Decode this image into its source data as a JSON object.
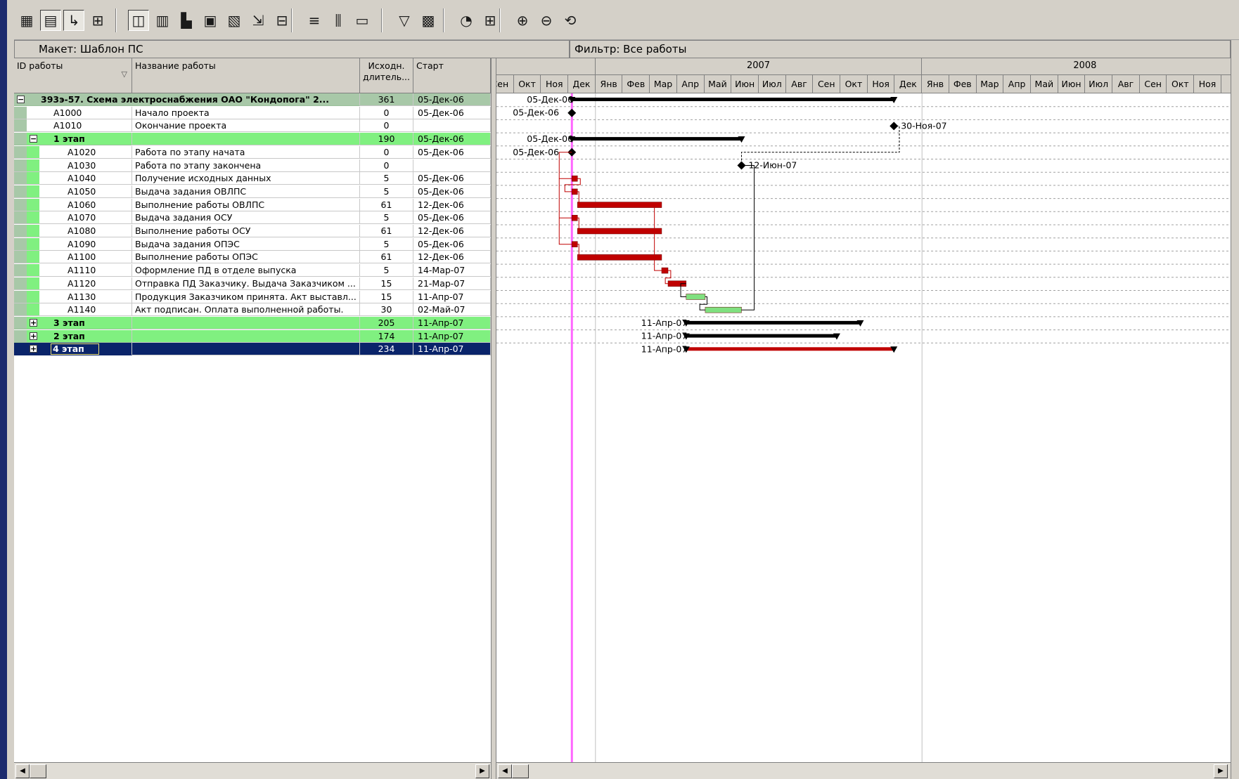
{
  "toolbar": {
    "buttons": [
      {
        "name": "table-view-icon",
        "glyph": "▦"
      },
      {
        "name": "gantt-view-icon",
        "glyph": "▤",
        "pressed": true
      },
      {
        "name": "relationship-lines-icon",
        "glyph": "↳",
        "pressed": true
      },
      {
        "name": "network-view-icon",
        "glyph": "⊞"
      },
      {
        "name": "bar-chart-view-icon",
        "glyph": "◫",
        "pressed": true
      },
      {
        "name": "resource-table-icon",
        "glyph": "▥"
      },
      {
        "name": "histogram-icon",
        "glyph": "▙"
      },
      {
        "name": "spreadsheet-icon",
        "glyph": "▣"
      },
      {
        "name": "profile-icon",
        "glyph": "▧"
      },
      {
        "name": "trace-logic-icon",
        "glyph": "⇲"
      },
      {
        "name": "schedule-icon",
        "glyph": "⊟"
      },
      {
        "name": "bars-icon",
        "glyph": "≡"
      },
      {
        "name": "columns-icon",
        "glyph": "⫼"
      },
      {
        "name": "format-icon",
        "glyph": "▭"
      },
      {
        "name": "filter-icon",
        "glyph": "▽"
      },
      {
        "name": "layout-icon",
        "glyph": "▩"
      },
      {
        "name": "progress-spotlight-icon",
        "glyph": "◔"
      },
      {
        "name": "grouping-icon",
        "glyph": "⊞"
      },
      {
        "name": "zoom-in-icon",
        "glyph": "⊕"
      },
      {
        "name": "zoom-out-icon",
        "glyph": "⊖"
      },
      {
        "name": "zoom-reset-icon",
        "glyph": "⟲"
      }
    ]
  },
  "layout": {
    "label": "Макет: Шаблон ПС"
  },
  "filter": {
    "label": "Фильтр: Все работы"
  },
  "table": {
    "headers": {
      "id": "ID работы",
      "name": "Название работы",
      "duration": "Исходн.\nдлитель...",
      "start": "Старт"
    },
    "rows": [
      {
        "level": 0,
        "type": "wbs0",
        "expander": "−",
        "id": "393э-57. Схема электроснабжения ОАО \"Кондопога\" 2...",
        "name": "",
        "duration": "361",
        "start": "05-Дек-06"
      },
      {
        "level": 1,
        "type": "task",
        "id": "A1000",
        "name": "Начало проекта",
        "duration": "0",
        "start": "05-Дек-06"
      },
      {
        "level": 1,
        "type": "task",
        "id": "A1010",
        "name": "Окончание проекта",
        "duration": "0",
        "start": ""
      },
      {
        "level": 1,
        "type": "wbs1",
        "expander": "−",
        "id": "1 этап",
        "name": "",
        "duration": "190",
        "start": "05-Дек-06"
      },
      {
        "level": 2,
        "type": "task",
        "id": "A1020",
        "name": "Работа по этапу начата",
        "duration": "0",
        "start": "05-Дек-06"
      },
      {
        "level": 2,
        "type": "task",
        "id": "A1030",
        "name": "Работа по этапу закончена",
        "duration": "0",
        "start": ""
      },
      {
        "level": 2,
        "type": "task",
        "id": "A1040",
        "name": "Получение исходных данных",
        "duration": "5",
        "start": "05-Дек-06"
      },
      {
        "level": 2,
        "type": "task",
        "id": "A1050",
        "name": "Выдача задания ОВЛПС",
        "duration": "5",
        "start": "05-Дек-06"
      },
      {
        "level": 2,
        "type": "task",
        "id": "A1060",
        "name": "Выполнение работы ОВЛПС",
        "duration": "61",
        "start": "12-Дек-06"
      },
      {
        "level": 2,
        "type": "task",
        "id": "A1070",
        "name": "Выдача задания ОСУ",
        "duration": "5",
        "start": "05-Дек-06"
      },
      {
        "level": 2,
        "type": "task",
        "id": "A1080",
        "name": "Выполнение работы ОСУ",
        "duration": "61",
        "start": "12-Дек-06"
      },
      {
        "level": 2,
        "type": "task",
        "id": "A1090",
        "name": "Выдача задания ОПЭС",
        "duration": "5",
        "start": "05-Дек-06"
      },
      {
        "level": 2,
        "type": "task",
        "id": "A1100",
        "name": "Выполнение работы ОПЭС",
        "duration": "61",
        "start": "12-Дек-06"
      },
      {
        "level": 2,
        "type": "task",
        "id": "A1110",
        "name": "Оформление ПД в отделе выпуска",
        "duration": "5",
        "start": "14-Мар-07"
      },
      {
        "level": 2,
        "type": "task",
        "id": "A1120",
        "name": "Отправка ПД Заказчику. Выдача Заказчиком ...",
        "duration": "15",
        "start": "21-Мар-07"
      },
      {
        "level": 2,
        "type": "task",
        "id": "A1130",
        "name": "Продукция Заказчиком принята. Акт выставл...",
        "duration": "15",
        "start": "11-Апр-07"
      },
      {
        "level": 2,
        "type": "task",
        "id": "A1140",
        "name": "Акт подписан. Оплата выполненной работы.",
        "duration": "30",
        "start": "02-Май-07"
      },
      {
        "level": 1,
        "type": "wbs1",
        "expander": "+",
        "id": "3 этап",
        "name": "",
        "duration": "205",
        "start": "11-Апр-07"
      },
      {
        "level": 1,
        "type": "wbs1",
        "expander": "+",
        "id": "2 этап",
        "name": "",
        "duration": "174",
        "start": "11-Апр-07"
      },
      {
        "level": 1,
        "type": "selected",
        "expander": "+",
        "id": "4 этап",
        "name": "",
        "duration": "234",
        "start": "11-Апр-07"
      }
    ]
  },
  "gantt": {
    "years": [
      "2007",
      "2008"
    ],
    "months": [
      "Сен",
      "Окт",
      "Ноя",
      "Дек",
      "Янв",
      "Фев",
      "Мар",
      "Апр",
      "Май",
      "Июн",
      "Июл",
      "Авг",
      "Сен",
      "Окт",
      "Ноя",
      "Дек",
      "Янв",
      "Фев",
      "Мар",
      "Апр",
      "Май",
      "Июн",
      "Июл",
      "Авг",
      "Сен",
      "Окт",
      "Ноя"
    ],
    "data_date": "05-Дек-06",
    "bar_labels": [
      {
        "row": 0,
        "text": "05-Дек-06"
      },
      {
        "row": 1,
        "text": "05-Дек-06"
      },
      {
        "row": 2,
        "text": "30-Ноя-07"
      },
      {
        "row": 3,
        "text": "05-Дек-06"
      },
      {
        "row": 4,
        "text": "05-Дек-06"
      },
      {
        "row": 5,
        "text": "12-Июн-07"
      },
      {
        "row": 17,
        "text": "11-Апр-07"
      },
      {
        "row": 18,
        "text": "11-Апр-07"
      },
      {
        "row": 19,
        "text": "11-Апр-07"
      }
    ]
  },
  "colors": {
    "wbs0": "#a8c8a8",
    "wbs1": "#80f080",
    "selected": "#0a246a",
    "bar_critical": "#c00000",
    "bar_normal": "#80e080",
    "data_date_line": "#ff66ff"
  }
}
